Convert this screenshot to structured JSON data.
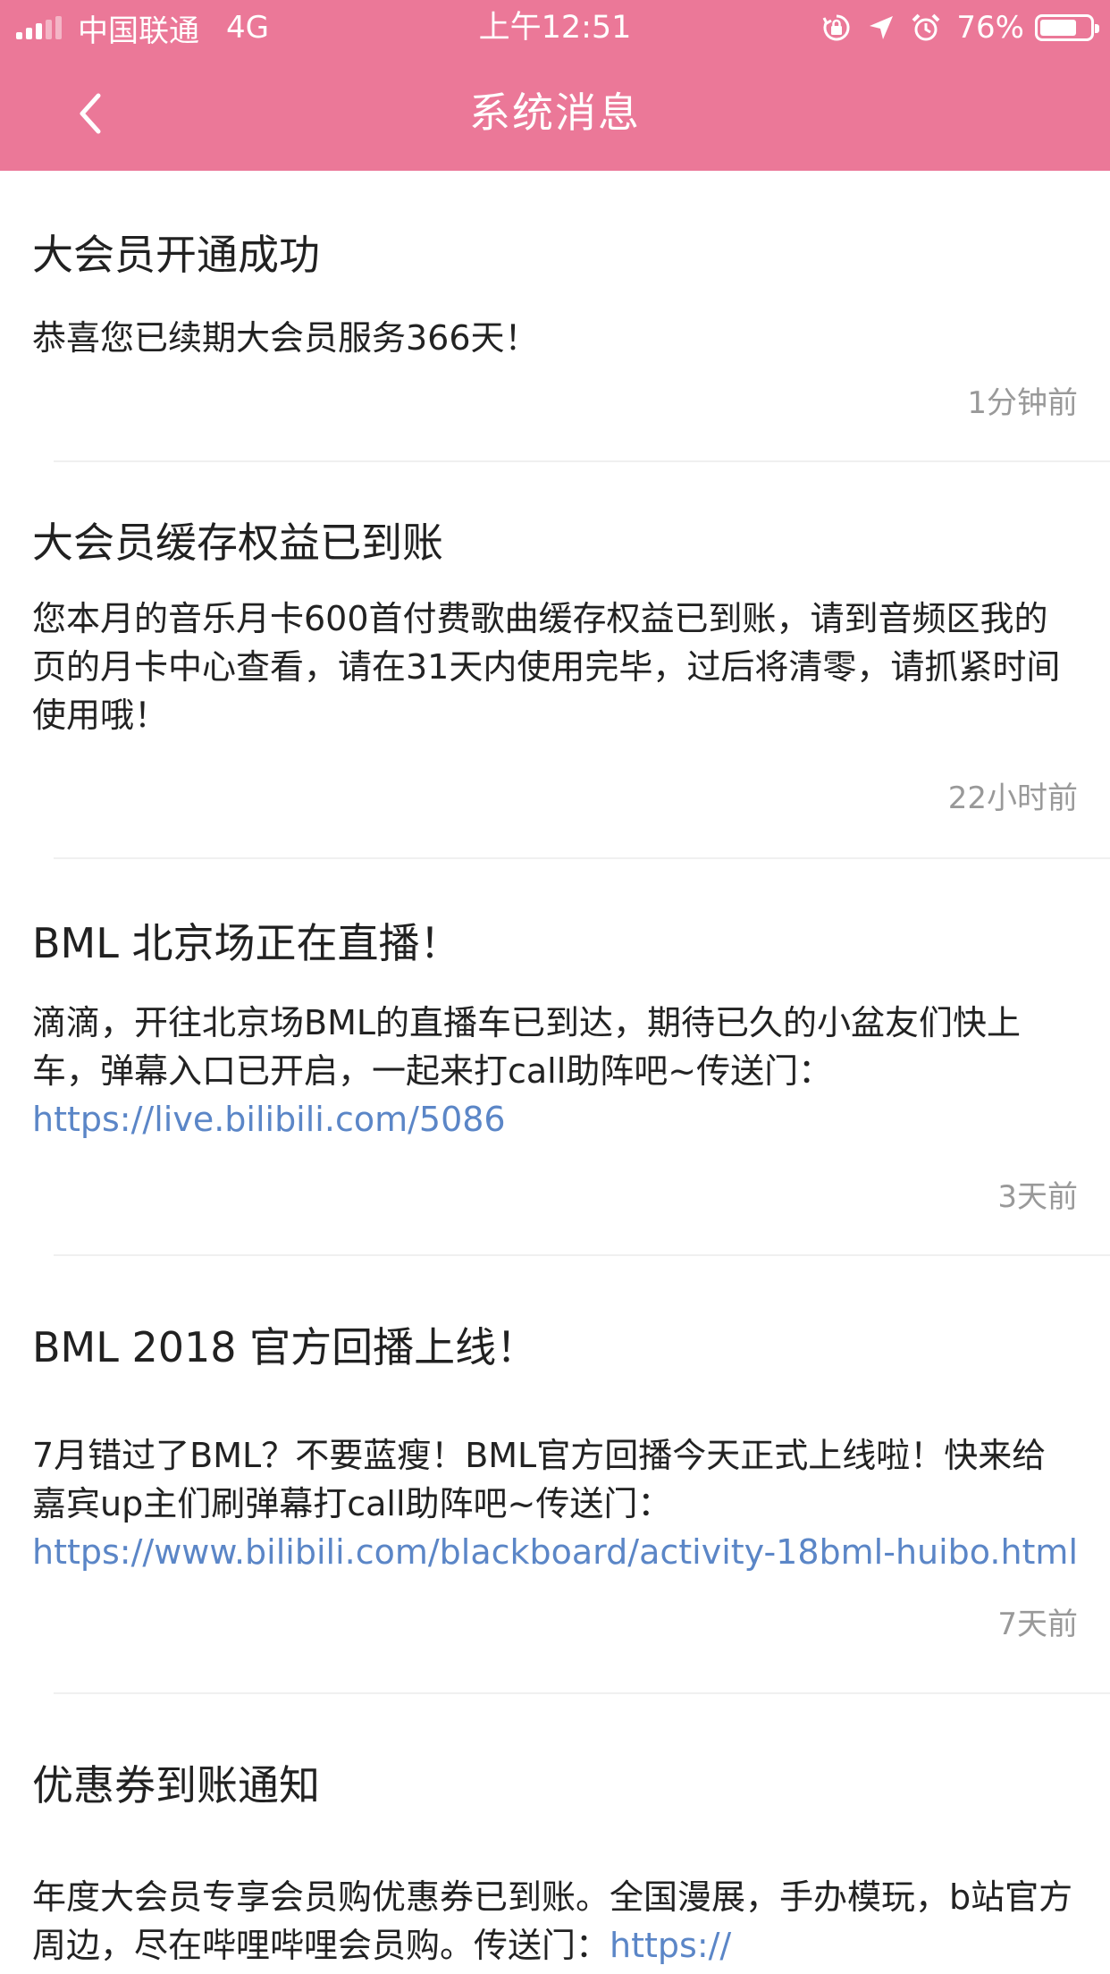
{
  "status_bar": {
    "carrier": "中国联通",
    "network": "4G",
    "time": "上午12:51",
    "battery_percent": "76%",
    "battery_level": 0.76,
    "icons": [
      "signal-icon",
      "orientation-lock-icon",
      "location-icon",
      "alarm-icon",
      "battery-icon"
    ]
  },
  "nav": {
    "title": "系统消息",
    "back_icon": "chevron-left-icon"
  },
  "colors": {
    "header": "#eb7898",
    "link": "#5b86c7",
    "time": "#999999",
    "divider": "#f0f0f0"
  },
  "messages": [
    {
      "title": "大会员开通成功",
      "body_text": "恭喜您已续期大会员服务366天！",
      "body_link": "",
      "time": "1分钟前"
    },
    {
      "title": "大会员缓存权益已到账",
      "body_text": "您本月的音乐月卡600首付费歌曲缓存权益已到账，请到音频区我的页的月卡中心查看，请在31天内使用完毕，过后将清零，请抓紧时间使用哦！",
      "body_link": "",
      "time": "22小时前"
    },
    {
      "title": "BML  北京场正在直播！",
      "body_text": "滴滴，开往北京场BML的直播车已到达，期待已久的小盆友们快上车，弹幕入口已开启，一起来打call助阵吧~传送门：",
      "body_link": "https://live.bilibili.com/5086",
      "time": "3天前"
    },
    {
      "title": "BML  2018  官方回播上线！",
      "body_text": "7月错过了BML？不要蓝瘦！BML官方回播今天正式上线啦！快来给嘉宾up主们刷弹幕打call助阵吧~传送门：",
      "body_link": "https://www.bilibili.com/blackboard/activity-18bml-huibo.html",
      "time": "7天前"
    },
    {
      "title": "优惠券到账通知",
      "body_text": "年度大会员专享会员购优惠券已到账。全国漫展，手办模玩，b站官方周边，尽在哔哩哔哩会员购。传送门：",
      "body_link": "https://",
      "time": ""
    }
  ]
}
